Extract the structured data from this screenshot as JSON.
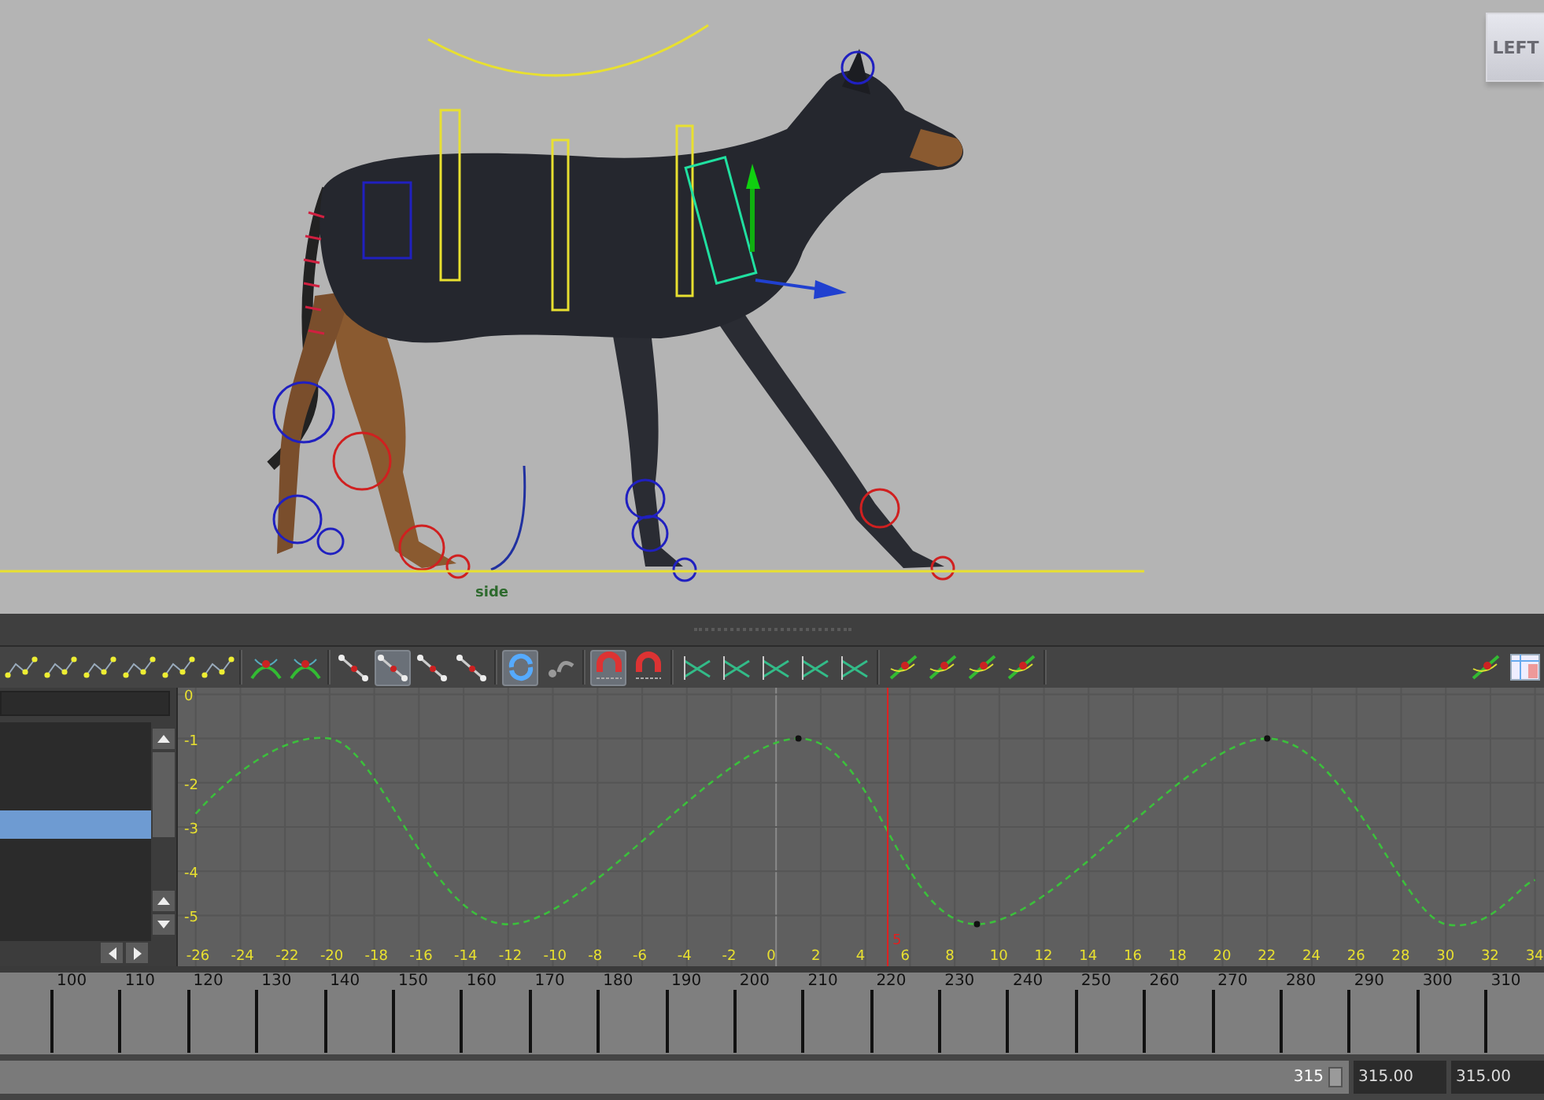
{
  "viewport": {
    "view_cube": "LEFT",
    "camera_label": "side"
  },
  "graph_editor": {
    "toolbar": [
      {
        "kind": "keyline",
        "on": false
      },
      {
        "kind": "keyline",
        "on": false
      },
      {
        "kind": "keyline",
        "on": false
      },
      {
        "kind": "keyline",
        "on": false
      },
      {
        "kind": "keyline",
        "on": false
      },
      {
        "kind": "keyline",
        "on": false
      },
      {
        "kind": "separator"
      },
      {
        "kind": "curve",
        "on": false
      },
      {
        "kind": "curve",
        "on": false
      },
      {
        "kind": "separator"
      },
      {
        "kind": "tangent",
        "on": false
      },
      {
        "kind": "tangent",
        "on": true
      },
      {
        "kind": "tangent",
        "on": false
      },
      {
        "kind": "tangent",
        "on": false
      },
      {
        "kind": "separator"
      },
      {
        "kind": "cycle",
        "on": true
      },
      {
        "kind": "arrow",
        "on": false
      },
      {
        "kind": "separator"
      },
      {
        "kind": "magnet",
        "on": true
      },
      {
        "kind": "magnet",
        "on": false
      },
      {
        "kind": "separator"
      },
      {
        "kind": "buffer",
        "on": false
      },
      {
        "kind": "buffer",
        "on": false
      },
      {
        "kind": "buffer",
        "on": false
      },
      {
        "kind": "buffer",
        "on": false
      },
      {
        "kind": "buffer",
        "on": false
      },
      {
        "kind": "separator"
      },
      {
        "kind": "graph",
        "on": false
      },
      {
        "kind": "graph",
        "on": false
      },
      {
        "kind": "graph",
        "on": false
      },
      {
        "kind": "graph",
        "on": false
      },
      {
        "kind": "separator"
      },
      {
        "kind": "spacer"
      },
      {
        "kind": "graph",
        "on": false
      },
      {
        "kind": "table",
        "on": false
      }
    ],
    "outliner": {
      "rows": [
        {
          "selected": false
        },
        {
          "selected": false
        },
        {
          "selected": false
        },
        {
          "selected": true
        },
        {
          "selected": false
        },
        {
          "selected": false
        },
        {
          "selected": false
        }
      ]
    },
    "graph": {
      "chart_data": {
        "type": "line",
        "grid": true,
        "line_style": "dashed",
        "x": [
          -26,
          -20,
          -12,
          1,
          9,
          22,
          30,
          34
        ],
        "values": [
          -2.7,
          -1,
          -5.2,
          -1,
          -5.2,
          -1,
          -5.2,
          -4.2
        ],
        "xlim": [
          -26.8,
          34.4
        ],
        "ylim": [
          -6.15,
          0.15
        ],
        "xticks": [
          -26,
          -24,
          -22,
          -20,
          -18,
          -16,
          -14,
          -12,
          -10,
          -8,
          -6,
          -4,
          -2,
          0,
          2,
          4,
          6,
          8,
          10,
          12,
          14,
          16,
          18,
          20,
          22,
          24,
          26,
          28,
          30,
          32,
          34
        ],
        "yticks": [
          0,
          -1,
          -2,
          -3,
          -4,
          -5
        ],
        "ref_lines": [
          {
            "axis": "x",
            "value": 5,
            "color": "#e02020",
            "label": "5"
          }
        ]
      }
    }
  },
  "time_slider": {
    "ticks": [
      "100",
      "110",
      "120",
      "130",
      "140",
      "150",
      "160",
      "170",
      "180",
      "190",
      "200",
      "210",
      "220",
      "230",
      "240",
      "250",
      "260",
      "270",
      "280",
      "290",
      "300",
      "310"
    ]
  },
  "range_slider": {
    "level": 1,
    "end_label": "315",
    "start_field": "315.00",
    "end_field": "315.00"
  }
}
